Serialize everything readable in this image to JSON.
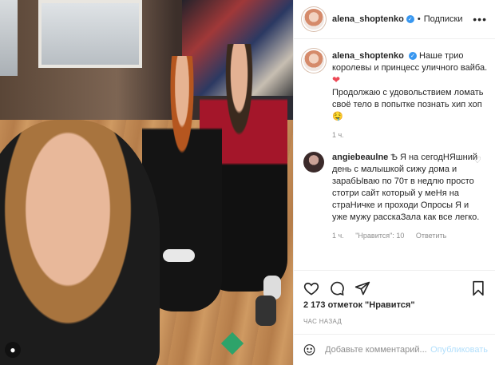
{
  "post": {
    "username": "alena_shoptenko",
    "verified": "✓",
    "dot": "•",
    "follow_label": "Подписки",
    "more": "•••"
  },
  "caption": {
    "username": "alena_shoptenko",
    "line1": "Наше трио королевы и принцесс уличного вайба.",
    "heart": "❤",
    "line2": "Продолжаю с удовольствием ломать своё тело в попытке познать хип хоп 🤤",
    "time": "1 ч."
  },
  "comment": {
    "username": "angiebeaulne",
    "text": "Ѣ Я на сегодНЯшний день с малышкой сижу дома и зарабЫваю по 70т в недлю просто стотри сайт который у меНя на страНичке и проходи Опросы Я и уже мужу расскаЗала как все легко.",
    "time": "1 ч.",
    "likes": "\"Нравится\": 10",
    "reply": "Ответить"
  },
  "stats": {
    "likes": "2 173 отметок \"Нравится\"",
    "timeago": "ЧАС НАЗАД"
  },
  "add_comment": {
    "placeholder": "Добавьте комментарий...",
    "publish": "Опубликовать"
  },
  "icons": [
    "like-icon",
    "comment-icon",
    "share-icon",
    "bookmark-icon",
    "emoji-icon",
    "user-tag-icon"
  ]
}
